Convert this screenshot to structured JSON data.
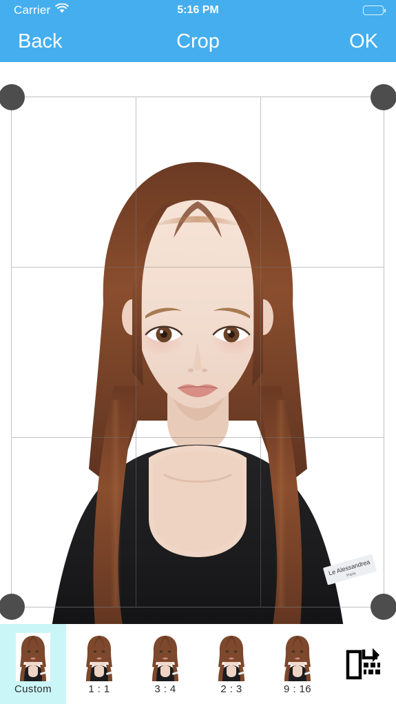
{
  "statusbar": {
    "carrier": "Carrier",
    "wifi_icon": "wifi-icon",
    "time": "5:16 PM",
    "battery_icon": "battery-full-icon"
  },
  "navbar": {
    "back_label": "Back",
    "title": "Crop",
    "ok_label": "OK"
  },
  "crop": {
    "grid_enabled": true,
    "handles": [
      "top-left",
      "top-right",
      "bottom-left",
      "bottom-right"
    ],
    "photo_label_text": "Le Alessandrea",
    "photo_label_subtext": "Paris"
  },
  "ratiobar": {
    "selected_index": 0,
    "selected_highlight_color": "#CBF6F7",
    "items": [
      {
        "label": "Custom"
      },
      {
        "label": "1 : 1"
      },
      {
        "label": "3 : 4"
      },
      {
        "label": "2 : 3"
      },
      {
        "label": "9 : 16"
      }
    ],
    "rotate_icon": "rotate-orientation-icon"
  },
  "colors": {
    "header_blue": "#45AEEE",
    "handle_gray": "#4D4D4D",
    "highlight_cyan": "#CBF6F7",
    "text_white": "#FFFFFF"
  }
}
